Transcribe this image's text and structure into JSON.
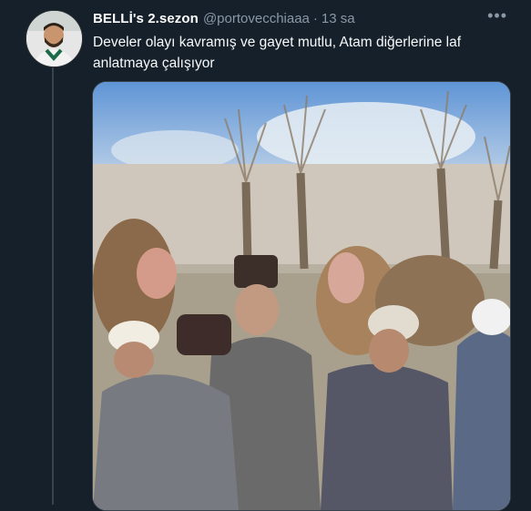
{
  "tweet": {
    "display_name": "BELLİ's 2.sezon",
    "handle": "@portovecchiaaa",
    "separator": "·",
    "time": "13 sa",
    "more_icon": "•••",
    "text": "Develer olayı kavramış ve gayet mutlu, Atam diğerlerine laf anlatmaya çalışıyor"
  },
  "colors": {
    "background": "#15202b",
    "text": "#f7f9f9",
    "muted": "#8b98a5",
    "divider": "#38444d"
  },
  "icons": {
    "avatar": "user-avatar-photo",
    "more": "more-horizontal-icon"
  }
}
